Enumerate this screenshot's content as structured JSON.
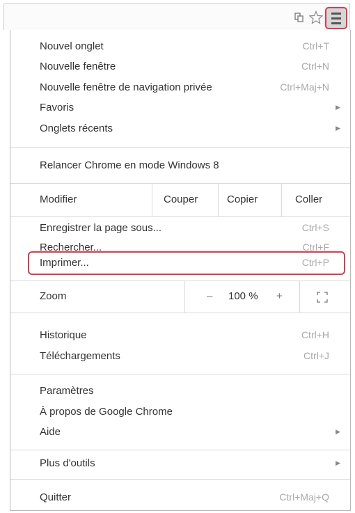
{
  "toolbar": {
    "icons": [
      "bookmark-page-icon",
      "star-icon",
      "menu-hamburger-icon"
    ]
  },
  "menu": {
    "group1": [
      {
        "label": "Nouvel onglet",
        "shortcut": "Ctrl+T"
      },
      {
        "label": "Nouvelle fenêtre",
        "shortcut": "Ctrl+N"
      },
      {
        "label": "Nouvelle fenêtre de navigation privée",
        "shortcut": "Ctrl+Maj+N"
      },
      {
        "label": "Favoris",
        "shortcut": ""
      },
      {
        "label": "Onglets récents",
        "shortcut": ""
      }
    ],
    "relaunch": "Relancer Chrome en mode Windows 8",
    "edit": {
      "label": "Modifier",
      "cut": "Couper",
      "copy": "Copier",
      "paste": "Coller"
    },
    "group2": [
      {
        "label": "Enregistrer la page sous...",
        "shortcut": "Ctrl+S"
      },
      {
        "label": "Rechercher...",
        "shortcut": "Ctrl+F"
      },
      {
        "label": "Imprimer...",
        "shortcut": "Ctrl+P"
      }
    ],
    "zoom": {
      "label": "Zoom",
      "minus": "–",
      "value": "100 %",
      "plus": "+"
    },
    "group3": [
      {
        "label": "Historique",
        "shortcut": "Ctrl+H"
      },
      {
        "label": "Téléchargements",
        "shortcut": "Ctrl+J"
      }
    ],
    "group4": [
      {
        "label": "Paramètres"
      },
      {
        "label": "À propos de Google Chrome"
      },
      {
        "label": "Aide"
      }
    ],
    "more_tools": "Plus d'outils",
    "quit": {
      "label": "Quitter",
      "shortcut": "Ctrl+Maj+Q"
    }
  },
  "colors": {
    "highlight": "#e03a4e",
    "shortcut_text": "#a9a9a9"
  }
}
